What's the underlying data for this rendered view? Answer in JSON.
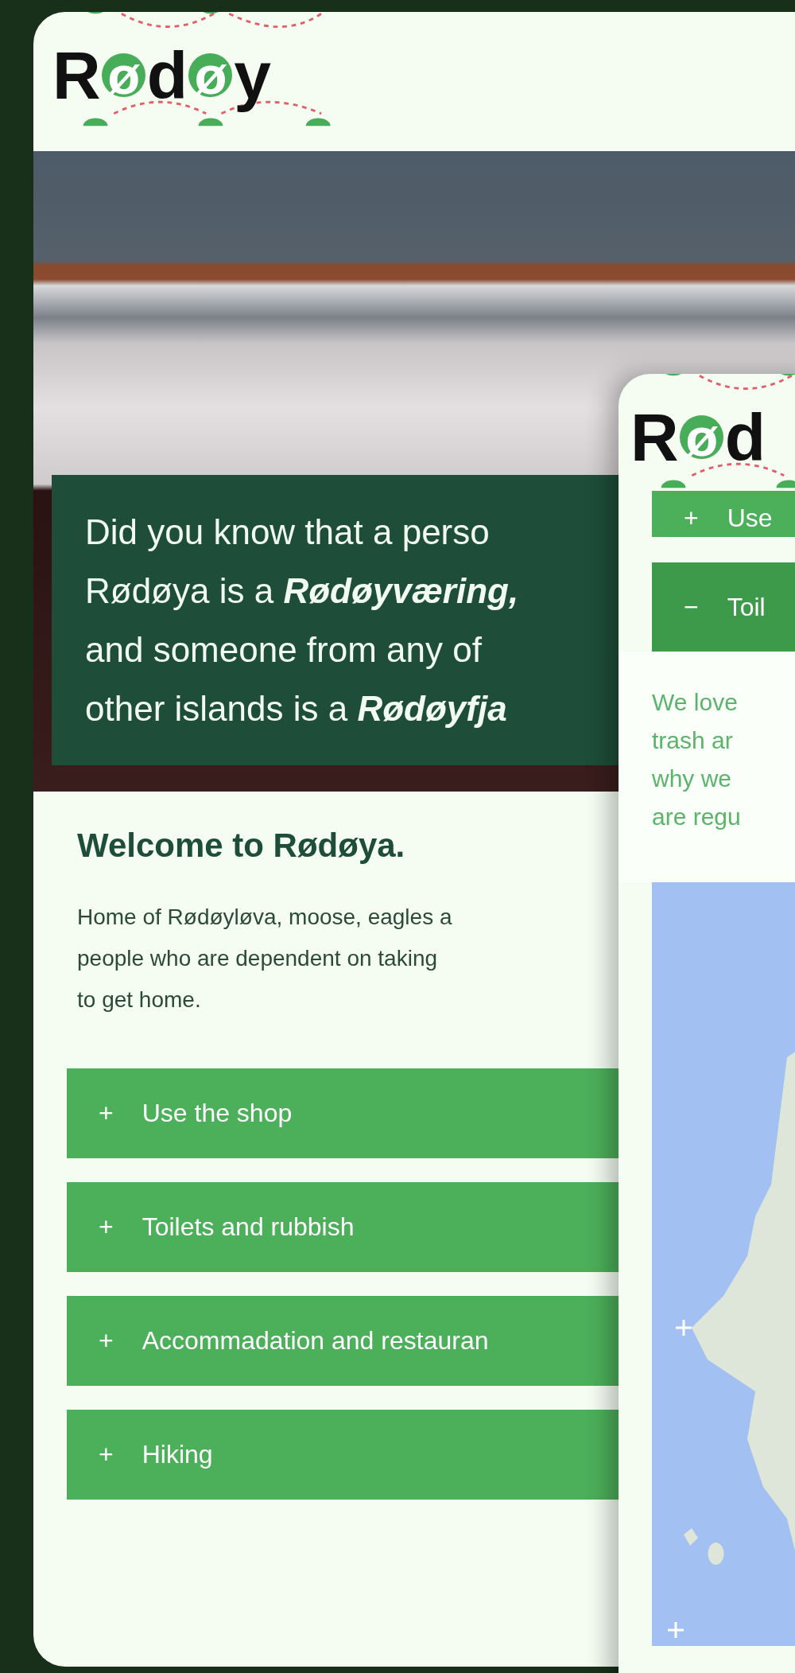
{
  "background_screen": {
    "logo": [
      {
        "char": "R",
        "kind": "plain"
      },
      {
        "char": "ø",
        "kind": "ring"
      },
      {
        "char": "d",
        "kind": "plain"
      },
      {
        "char": "ø",
        "kind": "ring"
      },
      {
        "char": "y",
        "kind": "plain"
      }
    ],
    "fact_card": {
      "lines": [
        "Did you know that a perso",
        "Rødøya is a **Rødøyværing,**",
        "and someone from any of",
        "other islands is a **Rødøyfja**"
      ]
    },
    "welcome": {
      "title": "Welcome to Rødøya.",
      "lines": [
        "Home of Rødøyløva, moose, eagles a",
        "people who are dependent on taking",
        "to get home."
      ]
    },
    "accordion": [
      {
        "icon": "+",
        "label": "Use the shop",
        "expanded": false
      },
      {
        "icon": "+",
        "label": "Toilets and rubbish",
        "expanded": false
      },
      {
        "icon": "+",
        "label": "Accommadation and restauran",
        "expanded": false
      },
      {
        "icon": "+",
        "label": "Hiking",
        "expanded": false
      }
    ]
  },
  "foreground_screen": {
    "logo": [
      {
        "char": "R",
        "kind": "plain"
      },
      {
        "char": "ø",
        "kind": "ring"
      },
      {
        "char": "d",
        "kind": "plain"
      }
    ],
    "accordion": [
      {
        "icon": "+",
        "label": "Use",
        "expanded": false
      },
      {
        "icon": "−",
        "label": "Toil",
        "expanded": true,
        "body_lines": [
          "We love",
          "trash ar",
          "why we",
          "are regu"
        ]
      }
    ]
  }
}
